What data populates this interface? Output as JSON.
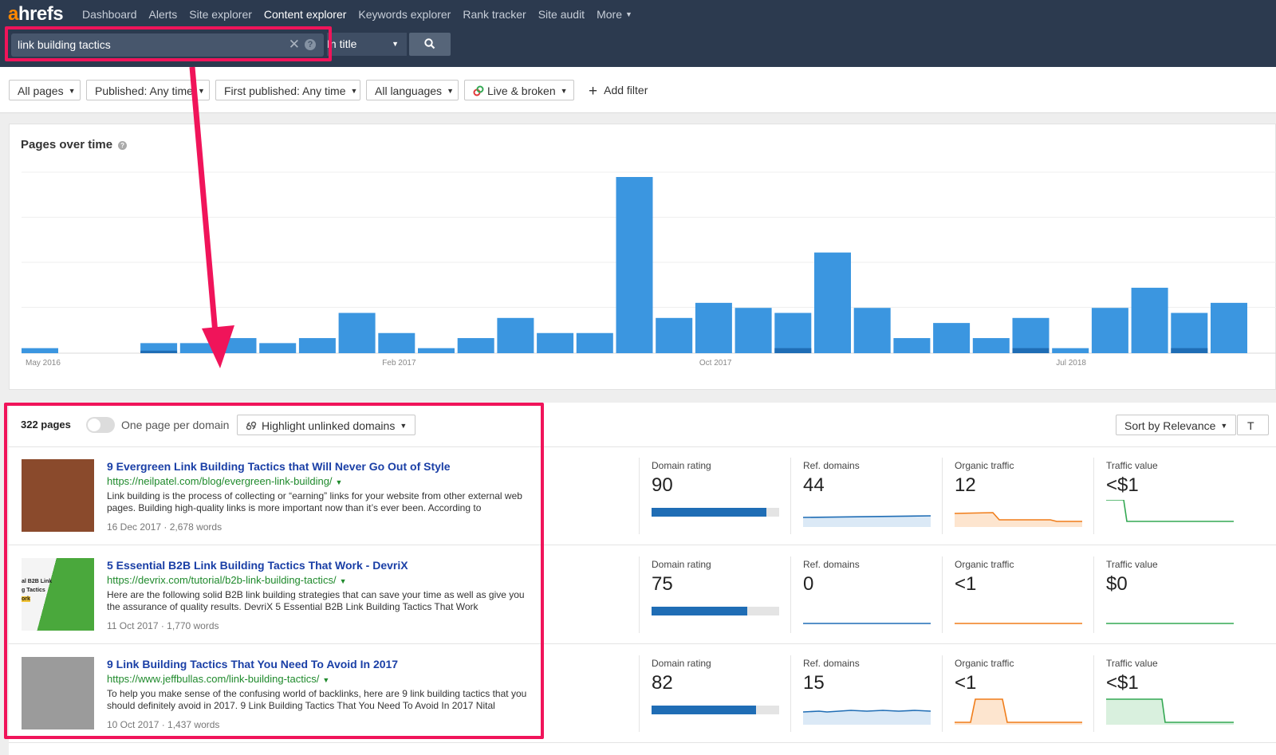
{
  "brand": {
    "logo_accent": "a",
    "logo_rest": "hrefs"
  },
  "nav": {
    "items": [
      "Dashboard",
      "Alerts",
      "Site explorer",
      "Content explorer",
      "Keywords explorer",
      "Rank tracker",
      "Site audit",
      "More"
    ],
    "active": "Content explorer"
  },
  "search": {
    "value": "link building tactics",
    "mode": "In title"
  },
  "filters": {
    "all_pages": "All pages",
    "published": "Published: Any time",
    "first_published": "First published: Any time",
    "languages": "All languages",
    "live_broken": "Live & broken",
    "add_filter": "Add filter"
  },
  "chart_data": {
    "type": "bar",
    "title": "Pages over time",
    "tick_labels": [
      "May 2016",
      "Feb 2017",
      "Oct 2017",
      "Jul 2018"
    ],
    "values": [
      1,
      0,
      0,
      2,
      2,
      3,
      2,
      3,
      8,
      4,
      1,
      3,
      7,
      4,
      4,
      35,
      7,
      10,
      9,
      8,
      20,
      9,
      3,
      6,
      3,
      7,
      1,
      9,
      13,
      8,
      10
    ],
    "dark_values": [
      0,
      0,
      0,
      0.5,
      0,
      0,
      0,
      0,
      0,
      0,
      0,
      0,
      0,
      0,
      0,
      0,
      0,
      0,
      0,
      1,
      0,
      0,
      0,
      0,
      0,
      1,
      0,
      0,
      0,
      1,
      0
    ],
    "ylim": [
      0,
      35
    ],
    "grid": true
  },
  "results_header": {
    "count": "322 pages",
    "one_per_domain": "One page per domain",
    "highlight": "Highlight unlinked domains",
    "sort": "Sort by Relevance",
    "edge_button": "T"
  },
  "metric_labels": {
    "dr": "Domain rating",
    "rd": "Ref. domains",
    "ot": "Organic traffic",
    "tv": "Traffic value"
  },
  "results": [
    {
      "title": "9 Evergreen Link Building Tactics that Will Never Go Out of Style",
      "url": "https://neilpatel.com/blog/evergreen-link-building/",
      "desc": "Link building is the process of collecting or “earning” links for your website from other external web pages. Building high-quality links is more important now than it’s ever been. According to",
      "date": "16 Dec 2017",
      "words": "2,678 words",
      "dr": "90",
      "dr_value": 90,
      "rd": "44",
      "ot": "12",
      "tv": "<$1",
      "thumb_color": "#8a4a2c"
    },
    {
      "title": "5 Essential B2B Link Building Tactics That Work - DevriX",
      "url": "https://devrix.com/tutorial/b2b-link-building-tactics/",
      "desc": "Here are the following solid B2B link building strategies that can save your time as well as give you the assurance of quality results. DevriX 5 Essential B2B Link Building Tactics That Work",
      "date": "11 Oct 2017",
      "words": "1,770 words",
      "dr": "75",
      "dr_value": 75,
      "rd": "0",
      "ot": "<1",
      "tv": "$0",
      "thumb_color": "#4aa83c",
      "thumb_text": [
        "al B2B Link",
        "g Tactics",
        "ork"
      ]
    },
    {
      "title": "9 Link Building Tactics That You Need To Avoid In 2017",
      "url": "https://www.jeffbullas.com/link-building-tactics/",
      "desc": "To help you make sense of the confusing world of backlinks, here are 9 link building tactics that you should definitely avoid in 2017. 9 Link Building Tactics That You Need To Avoid In 2017 Nital",
      "date": "10 Oct 2017",
      "words": "1,437 words",
      "dr": "82",
      "dr_value": 82,
      "rd": "15",
      "ot": "<1",
      "tv": "<$1",
      "thumb_color": "#9b9b9b"
    }
  ],
  "colors": {
    "bar": "#3b96e0",
    "bar_dark": "#1f6db5",
    "highlight": "#f0145a",
    "nav_bg": "#2c3a4f"
  }
}
